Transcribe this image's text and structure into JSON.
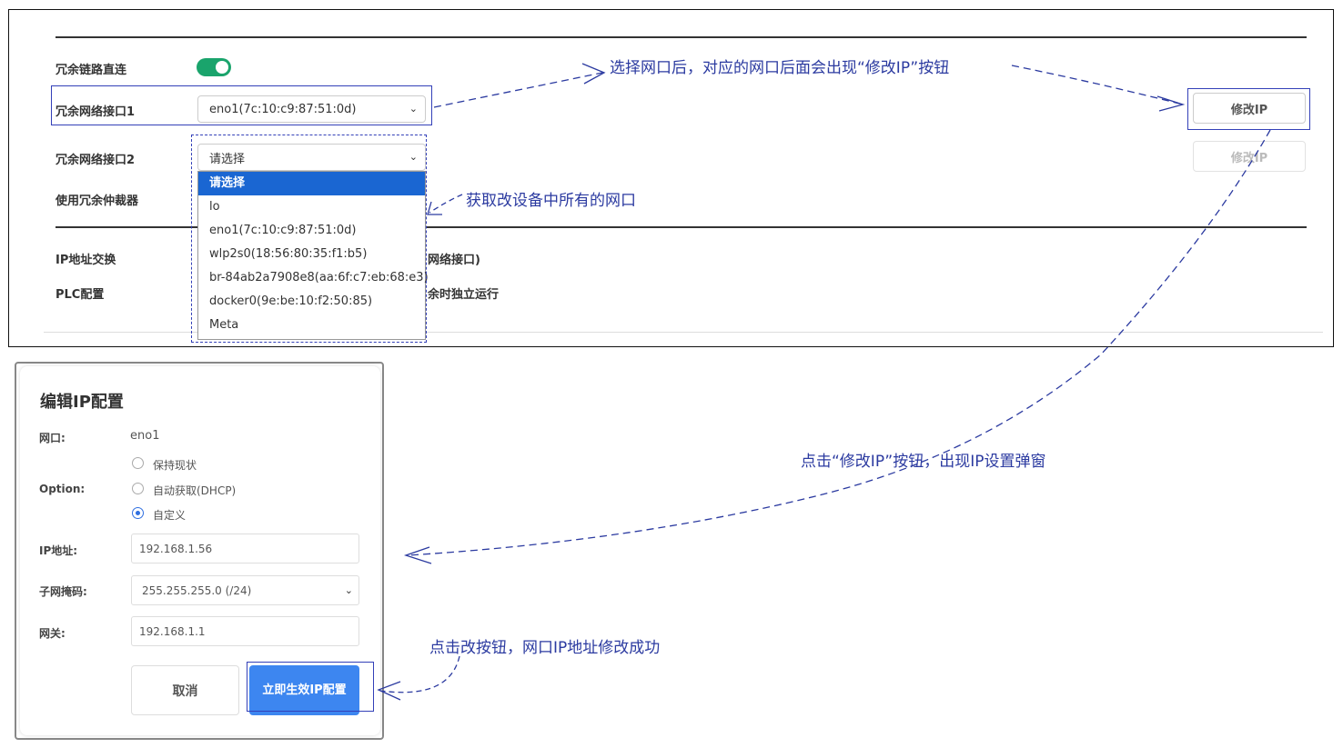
{
  "settings": {
    "redundant_direct_label": "冗余链路直连",
    "redundant_direct_enabled": true,
    "interface1_label": "冗余网络接口1",
    "interface1_value": "eno1(7c:10:c9:87:51:0d)",
    "interface2_label": "冗余网络接口2",
    "interface2_value": "请选择",
    "arbiter_label": "使用冗余仲裁器",
    "ip_swap_label": "IP地址交换",
    "ip_swap_value_partial": "网络接口)",
    "plc_label": "PLC配置",
    "plc_value_partial": "余时独立运行",
    "modify_ip_label": "修改IP",
    "modify_ip_disabled_label": "修改IP",
    "dropdown_options": [
      "请选择",
      "lo",
      "eno1(7c:10:c9:87:51:0d)",
      "wlp2s0(18:56:80:35:f1:b5)",
      "br-84ab2a7908e8(aa:6f:c7:eb:68:e3)",
      "docker0(9e:be:10:f2:50:85)",
      "Meta"
    ],
    "dropdown_selected_index": 0
  },
  "annotations": {
    "select_port": "选择网口后，对应的网口后面会出现“修改IP”按钮",
    "get_ports": "获取改设备中所有的网口",
    "click_modify": "点击“修改IP”按钮，出现IP设置弹窗",
    "click_apply": "点击改按钮，网口IP地址修改成功"
  },
  "modal": {
    "title": "编辑IP配置",
    "port_label": "网口:",
    "port_value": "eno1",
    "option_label": "Option:",
    "options": [
      "保持现状",
      "自动获取(DHCP)",
      "自定义"
    ],
    "selected_option_index": 2,
    "ip_label": "IP地址:",
    "ip_value": "192.168.1.56",
    "mask_label": "子网掩码:",
    "mask_value": "255.255.255.0 (/24)",
    "gateway_label": "网关:",
    "gateway_value": "192.168.1.1",
    "cancel_label": "取消",
    "apply_label": "立即生效IP配置"
  },
  "colors": {
    "accent_blue": "#3d86f0",
    "toggle_green": "#1aa46c",
    "dropdown_selected": "#1a66d2",
    "annotation_ink": "#2b3aa0"
  }
}
